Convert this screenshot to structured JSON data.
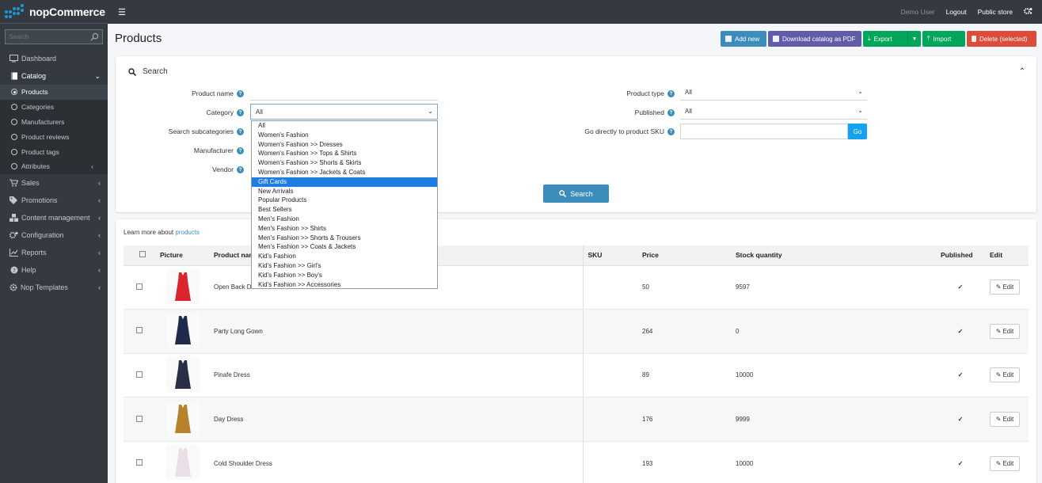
{
  "brand": {
    "name": "nopCommerce"
  },
  "topbar": {
    "user": "Demo User",
    "logout": "Logout",
    "public_store": "Public store"
  },
  "sidebar": {
    "search_placeholder": "Search",
    "dashboard": "Dashboard",
    "catalog": "Catalog",
    "catalog_items": [
      "Products",
      "Categories",
      "Manufacturers",
      "Product reviews",
      "Product tags",
      "Attributes"
    ],
    "sales": "Sales",
    "promotions": "Promotions",
    "content_management": "Content management",
    "configuration": "Configuration",
    "reports": "Reports",
    "help": "Help",
    "nop_templates": "Nop Templates"
  },
  "page": {
    "title": "Products"
  },
  "actions": {
    "add_new": "Add new",
    "download_pdf": "Download catalog as PDF",
    "export": "Export",
    "import": "Import",
    "delete_selected": "Delete (selected)"
  },
  "search": {
    "heading": "Search",
    "product_name_label": "Product name",
    "category_label": "Category",
    "category_value": "All",
    "search_subcategories_label": "Search subcategories",
    "manufacturer_label": "Manufacturer",
    "vendor_label": "Vendor",
    "product_type_label": "Product type",
    "product_type_value": "All",
    "published_label": "Published",
    "published_value": "All",
    "sku_label": "Go directly to product SKU",
    "go": "Go",
    "search_button": "Search"
  },
  "category_options": [
    "All",
    "Women's Fashion",
    "Women's Fashion >> Dresses",
    "Women's Fashion >> Tops & Shirts",
    "Women's Fashion >> Shorts & Skirts",
    "Women's Fashion >> Jackets & Coats",
    "Gift Cards",
    "New Arrivals",
    "Popular Products",
    "Best Sellers",
    "Men's Fashion",
    "Men's Fashion >> Shirts",
    "Men's Fashion >> Shorts & Trousers",
    "Men's Fashion >> Coats & Jackets",
    "Kid's Fashion",
    "Kid's Fashion >> Girl's",
    "Kid's Fashion >> Boy's",
    "Kid's Fashion >> Accessories"
  ],
  "category_selected": "Gift Cards",
  "table": {
    "learn_prefix": "Learn more about ",
    "learn_link": "products",
    "headers": {
      "picture": "Picture",
      "name": "Product name",
      "sku": "SKU",
      "price": "Price",
      "stock": "Stock quantity",
      "published": "Published",
      "edit": "Edit"
    },
    "edit_label": "Edit",
    "rows": [
      {
        "name": "Open Back Dress",
        "price": "50",
        "stock": "9597",
        "dress_color": "#d9262e"
      },
      {
        "name": "Party Long Gown",
        "price": "264",
        "stock": "0",
        "dress_color": "#1f2a4d"
      },
      {
        "name": "Pinafe Dress",
        "price": "89",
        "stock": "10000",
        "dress_color": "#2a2f45"
      },
      {
        "name": "Day Dress",
        "price": "176",
        "stock": "9999",
        "dress_color": "#b8822a"
      },
      {
        "name": "Cold Shoulder Dress",
        "price": "193",
        "stock": "10000",
        "dress_color": "#e8e0e6"
      }
    ]
  }
}
